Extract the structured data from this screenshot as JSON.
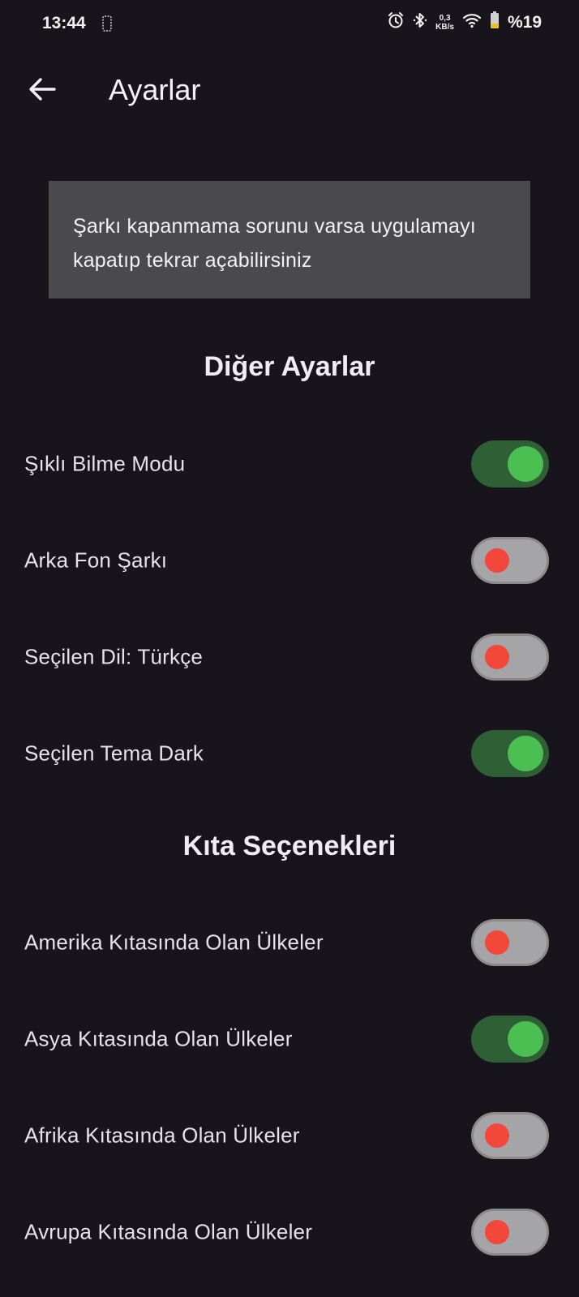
{
  "status_bar": {
    "time": "13:44",
    "speed_value": "0,3",
    "speed_unit": "KB/s",
    "battery": "%19",
    "icons": [
      "phone-outline-icon",
      "alarm-icon",
      "bluetooth-icon",
      "wifi-icon",
      "battery-icon"
    ]
  },
  "app_bar": {
    "title": "Ayarlar",
    "back_icon": "arrow-left-icon"
  },
  "notice": {
    "text": "Şarkı kapanmama sorunu varsa uygulamayı kapatıp tekrar açabilirsiniz"
  },
  "sections": {
    "other": {
      "title": "Diğer Ayarlar",
      "items": [
        {
          "label": "Şıklı Bilme Modu",
          "enabled": true
        },
        {
          "label": "Arka Fon Şarkı",
          "enabled": false
        },
        {
          "label": "Seçilen Dil: Türkçe",
          "enabled": false
        },
        {
          "label": "Seçilen Tema Dark",
          "enabled": true
        }
      ]
    },
    "continents": {
      "title": "Kıta Seçenekleri",
      "items": [
        {
          "label": "Amerika Kıtasında Olan Ülkeler",
          "enabled": false
        },
        {
          "label": "Asya Kıtasında Olan Ülkeler",
          "enabled": true
        },
        {
          "label": "Afrika Kıtasında Olan Ülkeler",
          "enabled": false
        },
        {
          "label": "Avrupa Kıtasında Olan Ülkeler",
          "enabled": false
        }
      ]
    }
  },
  "colors": {
    "background": "#17151b",
    "notice_bg": "#4a494b",
    "switch_on_track": "#2f5f34",
    "switch_on_knob": "#4cbf52",
    "switch_off_track": "#a5a4a7",
    "switch_off_knob": "#f2473a"
  }
}
